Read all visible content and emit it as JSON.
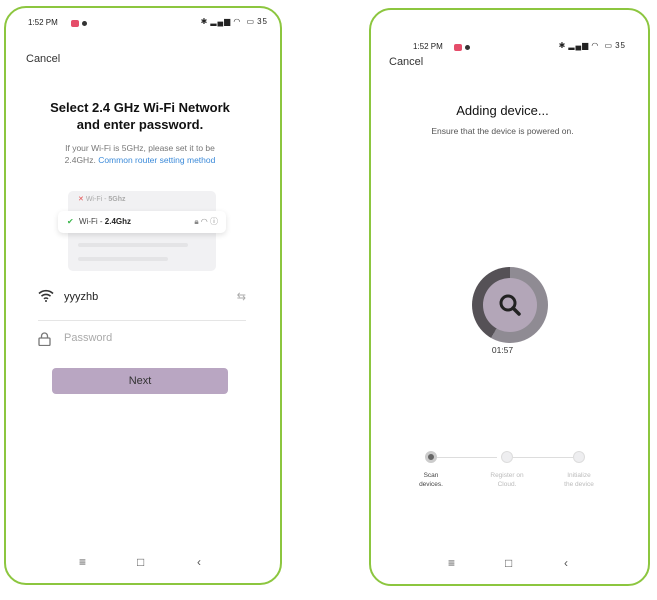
{
  "left_screen": {
    "status": {
      "time": "1:52 PM",
      "battery": "35"
    },
    "cancel_label": "Cancel",
    "title_line1": "Select 2.4 GHz Wi-Fi Network",
    "title_line2": "and enter password.",
    "subtitle_line1": "If your Wi-Fi is 5GHz, please set it to be",
    "subtitle_prefix": "2.4GHz.",
    "subtitle_link": "Common router setting method",
    "illustration": {
      "row1_prefix": "Wi-Fi - ",
      "row1_band": "5Ghz",
      "row2_prefix": "Wi-Fi - ",
      "row2_band": "2.4Ghz"
    },
    "wifi_name": "yyyzhb",
    "password_placeholder": "Password",
    "next_label": "Next"
  },
  "right_screen": {
    "status": {
      "time": "1:52 PM",
      "battery": "35"
    },
    "cancel_label": "Cancel",
    "title": "Adding device...",
    "subtitle": "Ensure that the device is powered on.",
    "timer": "01:57",
    "steps": [
      {
        "line1": "Scan",
        "line2": "devices."
      },
      {
        "line1": "Register on",
        "line2": "Cloud."
      },
      {
        "line1": "Initialize",
        "line2": "the device"
      }
    ]
  },
  "navbar": {
    "menu": "≡",
    "home": "□",
    "back": "‹"
  },
  "colors": {
    "frame": "#8cc63f",
    "button": "#b9a6c2",
    "link": "#3b8ad9"
  }
}
